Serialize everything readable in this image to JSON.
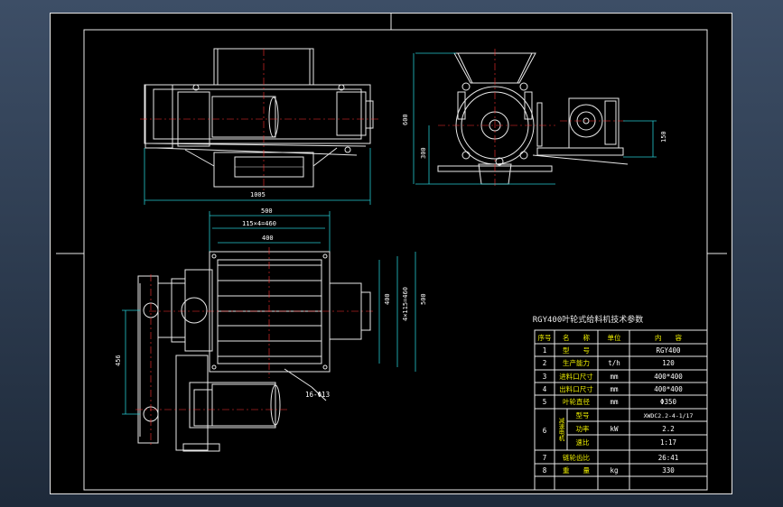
{
  "drawing": {
    "dims": {
      "top_width": "1005",
      "front_height": "600",
      "front_h300": "300",
      "front_h150": "150",
      "plan_width": "500",
      "plan_inner": "115×4=460",
      "plan_400": "400",
      "plan_side_400": "400",
      "plan_side_460": "4×115=460",
      "plan_side_500": "500",
      "plan_456": "456",
      "holes": "16-Φ13"
    },
    "table": {
      "title": "RGY400叶轮式给料机技术参数",
      "headers": [
        "序号",
        "名　　称",
        "单位",
        "内　　容"
      ],
      "rows": [
        {
          "no": "1",
          "name": "型　　号",
          "unit": "",
          "value": "RGY400"
        },
        {
          "no": "2",
          "name": "生产能力",
          "unit": "t/h",
          "value": "120"
        },
        {
          "no": "3",
          "name": "进料口尺寸",
          "unit": "mm",
          "value": "400*400"
        },
        {
          "no": "4",
          "name": "出料口尺寸",
          "unit": "mm",
          "value": "400*400"
        },
        {
          "no": "5",
          "name": "叶轮直径",
          "unit": "mm",
          "value": "Φ350"
        }
      ],
      "row6": {
        "no": "6",
        "group": "减速电机",
        "sub": [
          {
            "name": "型号",
            "unit": "",
            "value": "XWDC2.2-4-1/17"
          },
          {
            "name": "功率",
            "unit": "kW",
            "value": "2.2"
          },
          {
            "name": "速比",
            "unit": "",
            "value": "1:17"
          }
        ]
      },
      "rows_tail": [
        {
          "no": "7",
          "name": "链轮齿比",
          "unit": "",
          "value": "26:41"
        },
        {
          "no": "8",
          "name": "重　　量",
          "unit": "kg",
          "value": "330"
        }
      ]
    }
  }
}
